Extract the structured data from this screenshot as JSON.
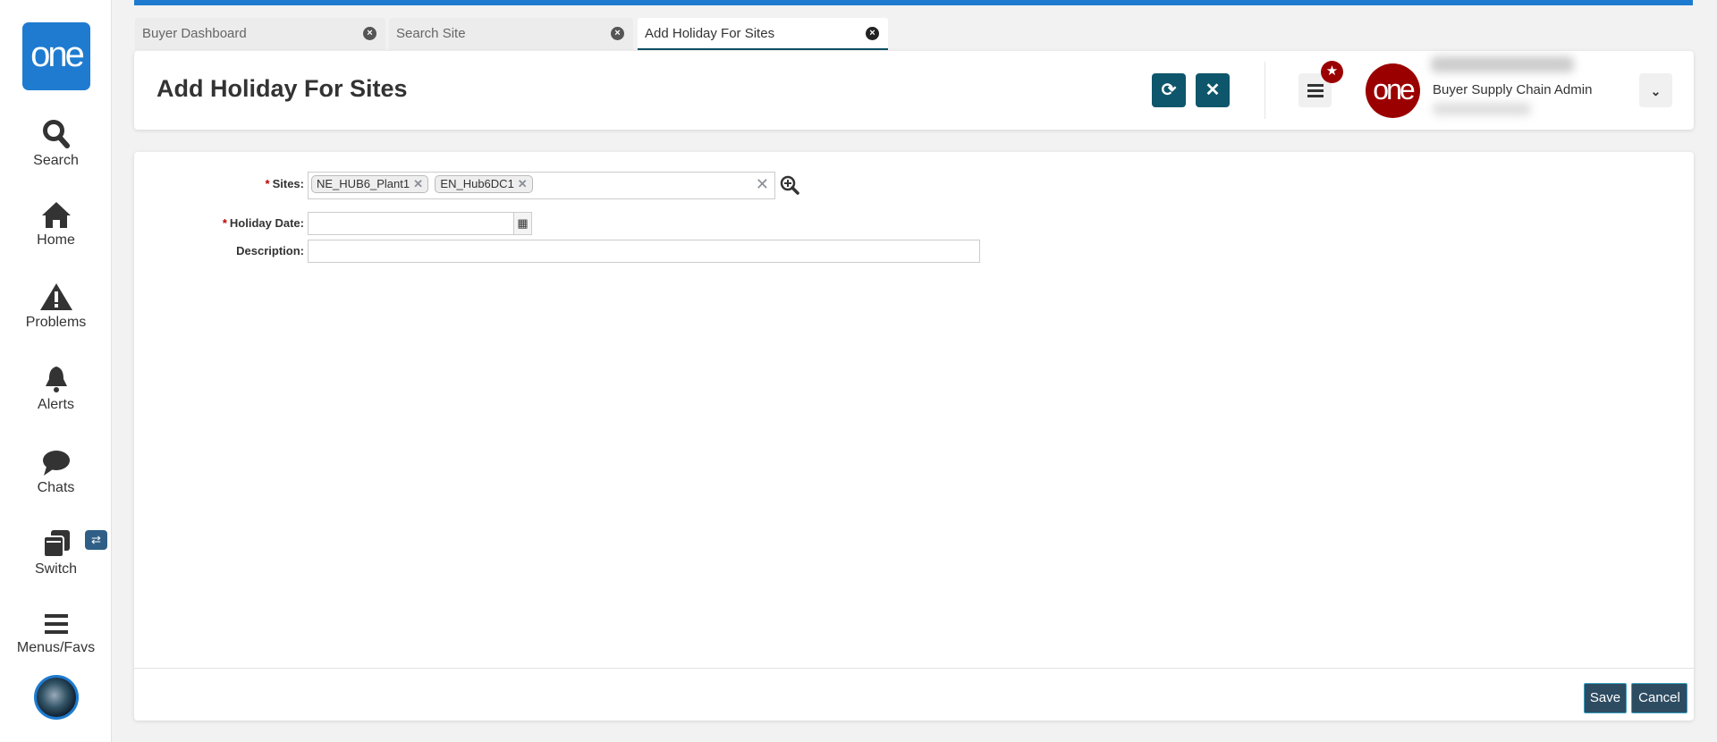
{
  "sidebar": {
    "logo": "one",
    "items": [
      {
        "label": "Search"
      },
      {
        "label": "Home"
      },
      {
        "label": "Problems"
      },
      {
        "label": "Alerts"
      },
      {
        "label": "Chats"
      },
      {
        "label": "Switch"
      },
      {
        "label": "Menus/Favs"
      }
    ]
  },
  "tabs": [
    {
      "label": "Buyer Dashboard"
    },
    {
      "label": "Search Site"
    },
    {
      "label": "Add Holiday For Sites",
      "active": true
    }
  ],
  "header": {
    "title": "Add Holiday For Sites",
    "user_role": "Buyer Supply Chain Admin",
    "logo": "one"
  },
  "form": {
    "sites_label": "Sites:",
    "sites": [
      "NE_HUB6_Plant1",
      "EN_Hub6DC1"
    ],
    "holiday_date_label": "Holiday Date:",
    "holiday_date": "",
    "description_label": "Description:",
    "description": "",
    "required_mark": "*"
  },
  "footer": {
    "save": "Save",
    "cancel": "Cancel"
  },
  "colors": {
    "brand": "#1e7bd0",
    "button": "#0e566b",
    "footer_button": "#2d4c62",
    "badge": "#9b0000"
  }
}
